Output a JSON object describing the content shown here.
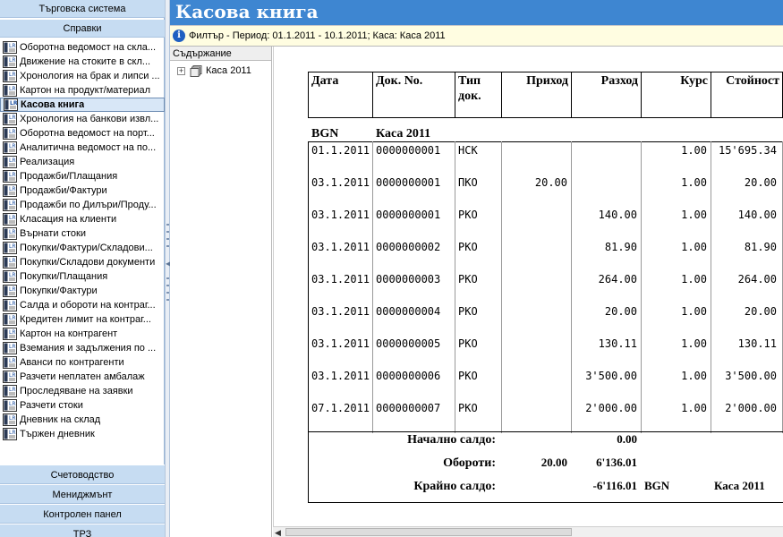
{
  "sidebar": {
    "section_system": "Търговска система",
    "section_reports": "Справки",
    "items": [
      "Оборотна ведомост на скла...",
      "Движение на стоките в скл...",
      "Хронология на брак и липси ...",
      "Картон на продукт/материал",
      "Касова книга",
      "Хронология на банкови извл...",
      "Оборотна ведомост на порт...",
      "Аналитична ведомост на по...",
      "Реализация",
      "Продажби/Плащания",
      "Продажби/Фактури",
      "Продажби по Дилъри/Проду...",
      "Класация на клиенти",
      "Върнати стоки",
      "Покупки/Фактури/Складови...",
      "Покупки/Складови документи",
      "Покупки/Плащания",
      "Покупки/Фактури",
      "Салда и обороти на контраг...",
      "Кредитен лимит на контраг...",
      "Картон на контрагент",
      "Вземания и задължения по ...",
      "Аванси по контрагенти",
      "Разчети неплатен амбалаж",
      "Проследяване на заявки",
      "Разчети стоки",
      "Дневник на склад",
      "Тържен дневник"
    ],
    "selected_index": 4,
    "bottom_sections": [
      "Счетоводство",
      "Мениджмънт",
      "Контролен панел",
      "ТРЗ"
    ]
  },
  "header": {
    "title": "Касова книга",
    "filter": "Филтър - Период: 01.1.2011 - 10.1.2011; Каса: Каса 2011"
  },
  "tree": {
    "title": "Съдържание",
    "node": "Каса 2011"
  },
  "report": {
    "columns": [
      "Дата",
      "Док. No.",
      "Тип док.",
      "Приход",
      "Разход",
      "Курс",
      "Стойност"
    ],
    "group_currency": "BGN",
    "group_name": "Каса 2011",
    "rows": [
      {
        "date": "01.1.2011",
        "doc": "0000000001",
        "type": "НСК",
        "income": "",
        "expense": "",
        "rate": "1.00",
        "value": "15'695.34"
      },
      {
        "date": "03.1.2011",
        "doc": "0000000001",
        "type": "ПКО",
        "income": "20.00",
        "expense": "",
        "rate": "1.00",
        "value": "20.00"
      },
      {
        "date": "03.1.2011",
        "doc": "0000000001",
        "type": "РКО",
        "income": "",
        "expense": "140.00",
        "rate": "1.00",
        "value": "140.00"
      },
      {
        "date": "03.1.2011",
        "doc": "0000000002",
        "type": "РКО",
        "income": "",
        "expense": "81.90",
        "rate": "1.00",
        "value": "81.90"
      },
      {
        "date": "03.1.2011",
        "doc": "0000000003",
        "type": "РКО",
        "income": "",
        "expense": "264.00",
        "rate": "1.00",
        "value": "264.00"
      },
      {
        "date": "03.1.2011",
        "doc": "0000000004",
        "type": "РКО",
        "income": "",
        "expense": "20.00",
        "rate": "1.00",
        "value": "20.00"
      },
      {
        "date": "03.1.2011",
        "doc": "0000000005",
        "type": "РКО",
        "income": "",
        "expense": "130.11",
        "rate": "1.00",
        "value": "130.11"
      },
      {
        "date": "03.1.2011",
        "doc": "0000000006",
        "type": "РКО",
        "income": "",
        "expense": "3'500.00",
        "rate": "1.00",
        "value": "3'500.00"
      },
      {
        "date": "07.1.2011",
        "doc": "0000000007",
        "type": "РКО",
        "income": "",
        "expense": "2'000.00",
        "rate": "1.00",
        "value": "2'000.00"
      }
    ],
    "summary": {
      "opening_label": "Начално салдо:",
      "opening_value": "0.00",
      "turnover_label": "Обороти:",
      "turnover_income": "20.00",
      "turnover_expense": "6'136.01",
      "closing_label": "Крайно салдо:",
      "closing_value": "-6'116.01",
      "closing_currency": "BGN",
      "closing_cash": "Каса 2011"
    }
  },
  "colors": {
    "title_bar": "#3e86d1",
    "sidebar_header": "#c6dcf2",
    "filter_bar": "#fffde1",
    "selected_item": "#d8e7f7"
  }
}
